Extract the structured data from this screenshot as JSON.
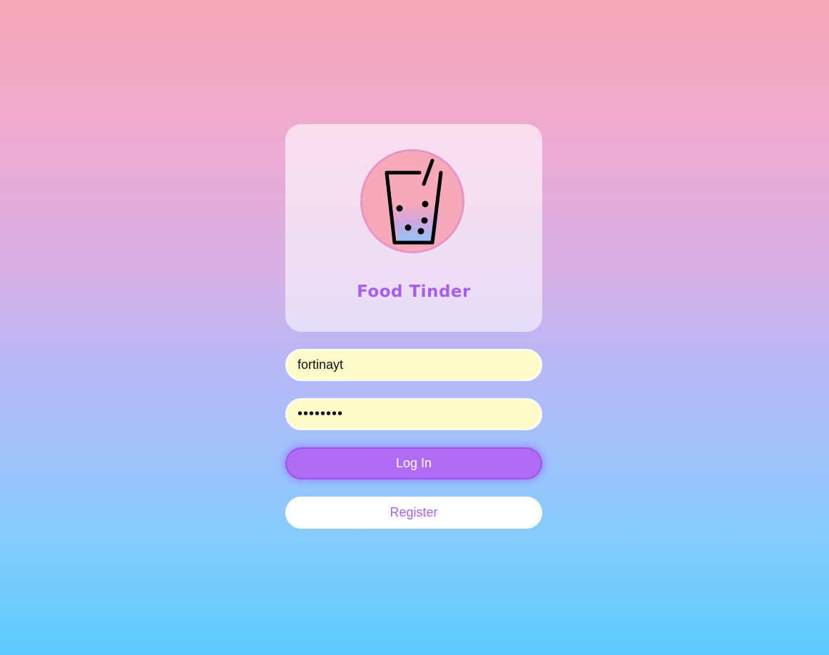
{
  "app": {
    "title": "Food Tinder",
    "logo_icon": "bubble-tea-cup-icon"
  },
  "login_form": {
    "username_value": "fortinayt",
    "password_value": "••••••••",
    "login_label": "Log In",
    "register_label": "Register"
  },
  "colors": {
    "accent": "#a65ef0",
    "input_background": "#fffbcb",
    "background_top": "#f7a8b8",
    "background_bottom": "#5ccafd"
  }
}
